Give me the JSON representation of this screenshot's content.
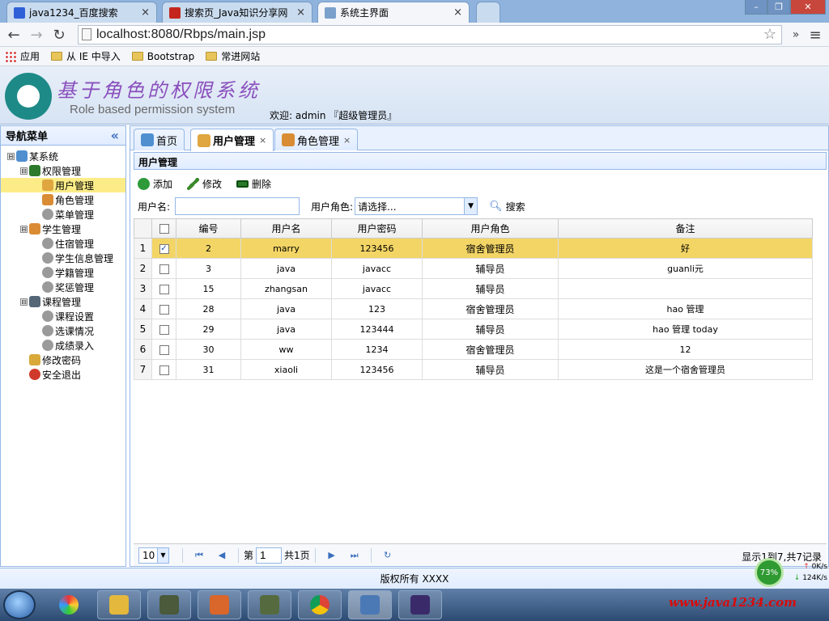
{
  "browser": {
    "tabs": [
      {
        "label": "java1234_百度搜索",
        "icon": "baidu-icon",
        "close": "×"
      },
      {
        "label": "搜索页_Java知识分享网",
        "icon": "java-j-icon",
        "close": "×"
      },
      {
        "label": "系统主界面",
        "icon": "page-icon",
        "close": "×"
      }
    ],
    "url": "localhost:8080/Rbps/main.jsp",
    "bookmarks": [
      "应用",
      "从 IE 中导入",
      "Bootstrap",
      "常进网站"
    ],
    "window_buttons": [
      "–",
      "❐",
      "✕"
    ],
    "more": "»",
    "menu": "≡"
  },
  "banner": {
    "title": "基于角色的权限系统",
    "subtitle": "Role based permission system",
    "welcome": "欢迎: admin 『超级管理员』"
  },
  "sidebar": {
    "title": "导航菜单",
    "collapse": "«",
    "tree": [
      {
        "label": "某系统",
        "level": 0,
        "toggle": "⊟",
        "icon": "house-icon"
      },
      {
        "label": "权限管理",
        "level": 1,
        "toggle": "⊟",
        "icon": "key-icon"
      },
      {
        "label": "用户管理",
        "level": 2,
        "toggle": "",
        "icon": "user-icon",
        "selected": true
      },
      {
        "label": "角色管理",
        "level": 2,
        "toggle": "",
        "icon": "users-icon"
      },
      {
        "label": "菜单管理",
        "level": 2,
        "toggle": "",
        "icon": "gear-icon"
      },
      {
        "label": "学生管理",
        "level": 1,
        "toggle": "⊟",
        "icon": "users-icon"
      },
      {
        "label": "住宿管理",
        "level": 2,
        "toggle": "",
        "icon": "gear-icon"
      },
      {
        "label": "学生信息管理",
        "level": 2,
        "toggle": "",
        "icon": "gear-icon"
      },
      {
        "label": "学籍管理",
        "level": 2,
        "toggle": "",
        "icon": "gear-icon"
      },
      {
        "label": "奖惩管理",
        "level": 2,
        "toggle": "",
        "icon": "gear-icon"
      },
      {
        "label": "课程管理",
        "level": 1,
        "toggle": "⊟",
        "icon": "monitor-icon"
      },
      {
        "label": "课程设置",
        "level": 2,
        "toggle": "",
        "icon": "gear-icon"
      },
      {
        "label": "选课情况",
        "level": 2,
        "toggle": "",
        "icon": "gear-icon"
      },
      {
        "label": "成绩录入",
        "level": 2,
        "toggle": "",
        "icon": "gear-icon"
      },
      {
        "label": "修改密码",
        "level": 1,
        "toggle": "",
        "icon": "lock-icon"
      },
      {
        "label": "安全退出",
        "level": 1,
        "toggle": "",
        "icon": "exit-icon"
      }
    ]
  },
  "tabs": [
    {
      "label": "首页",
      "icon": "house-icon",
      "close": ""
    },
    {
      "label": "用户管理",
      "icon": "user-icon",
      "close": "×"
    },
    {
      "label": "角色管理",
      "icon": "users-icon",
      "close": "×"
    }
  ],
  "panel": {
    "title": "用户管理",
    "toolbar": [
      {
        "label": "添加",
        "icon": "add-icon"
      },
      {
        "label": "修改",
        "icon": "edit-icon"
      },
      {
        "label": "删除",
        "icon": "delete-icon"
      }
    ],
    "search": {
      "username_label": "用户名:",
      "username_value": "",
      "role_label": "用户角色:",
      "role_value": "请选择...",
      "search_button": "搜索"
    }
  },
  "grid": {
    "headers": [
      "",
      "编号",
      "用户名",
      "用户密码",
      "用户角色",
      "备注"
    ],
    "rows": [
      {
        "rn": "1",
        "checked": true,
        "id": "2",
        "name": "marry",
        "pwd": "123456",
        "role": "宿舍管理员",
        "note": "好"
      },
      {
        "rn": "2",
        "checked": false,
        "id": "3",
        "name": "java",
        "pwd": "javacc",
        "role": "辅导员",
        "note": "guanli元"
      },
      {
        "rn": "3",
        "checked": false,
        "id": "15",
        "name": "zhangsan",
        "pwd": "javacc",
        "role": "辅导员",
        "note": ""
      },
      {
        "rn": "4",
        "checked": false,
        "id": "28",
        "name": "java",
        "pwd": "123",
        "role": "宿舍管理员",
        "note": "hao 管理"
      },
      {
        "rn": "5",
        "checked": false,
        "id": "29",
        "name": "java",
        "pwd": "123444",
        "role": "辅导员",
        "note": "hao 管理 today"
      },
      {
        "rn": "6",
        "checked": false,
        "id": "30",
        "name": "ww",
        "pwd": "1234",
        "role": "宿舍管理员",
        "note": "12"
      },
      {
        "rn": "7",
        "checked": false,
        "id": "31",
        "name": "xiaoli",
        "pwd": "123456",
        "role": "辅导员",
        "note": "这是一个宿舍管理员"
      }
    ]
  },
  "pager": {
    "page_size": "10",
    "page_label": "第",
    "page_value": "1",
    "total_pages": "共1页",
    "info": "显示1到7,共7记录"
  },
  "footer": {
    "text": "版权所有 XXXX"
  },
  "net_widget": {
    "percent": "73%",
    "up": "0K/s",
    "down": "124K/s"
  },
  "taskbar": {
    "watermark": "www.java1234.com"
  }
}
